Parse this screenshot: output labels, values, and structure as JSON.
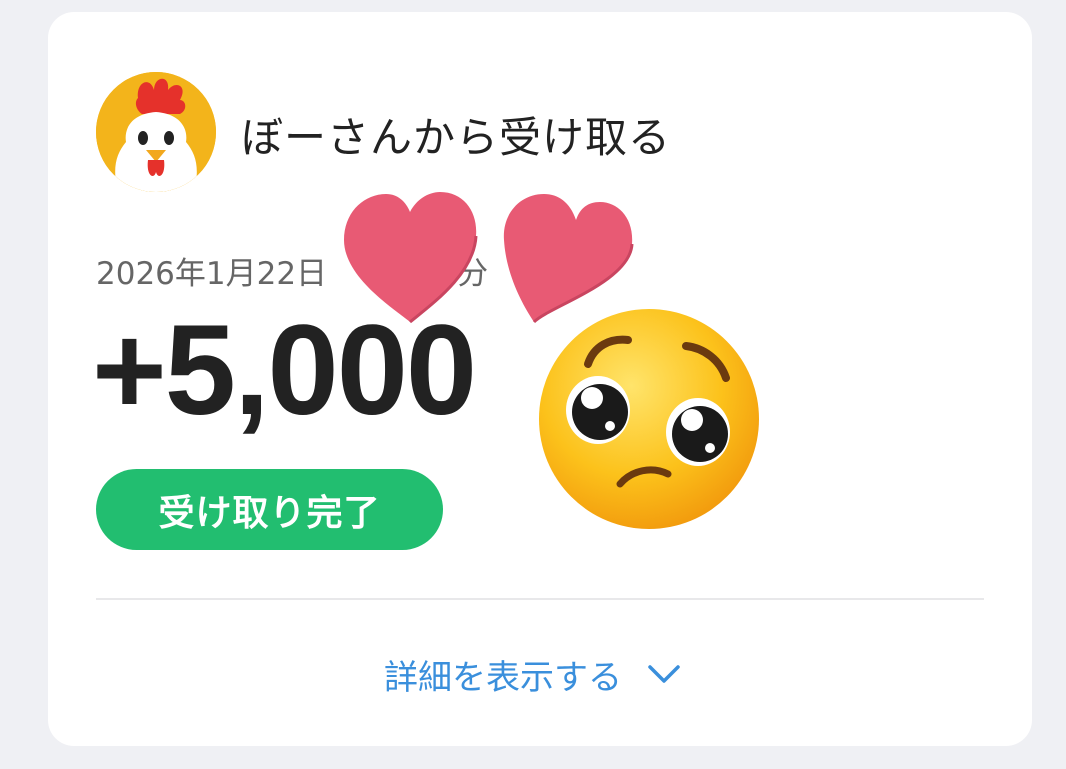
{
  "transfer": {
    "sender_line": "ぼーさんから受け取る",
    "date_prefix": "2026年1月22日",
    "date_suffix": "分",
    "amount": "+5,000",
    "status": "受け取り完了"
  },
  "footer": {
    "details_label": "詳細を表示する",
    "details_icon": "chevron-down-icon"
  },
  "stickers": [
    "heart-left",
    "heart-right",
    "pleading-face"
  ],
  "colors": {
    "background": "#eff0f4",
    "card": "#ffffff",
    "status_green": "#22be70",
    "link_blue": "#3a8fdc",
    "heart_pink": "#e85a74",
    "avatar_yellow": "#f3b41b"
  }
}
